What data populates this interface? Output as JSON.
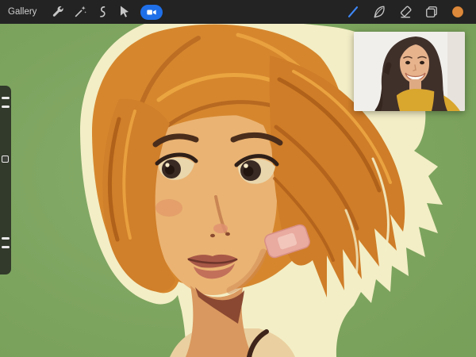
{
  "topbar": {
    "gallery_label": "Gallery",
    "tools_left": [
      {
        "name": "actions-wrench"
      },
      {
        "name": "adjustments-wand"
      },
      {
        "name": "selection-s"
      },
      {
        "name": "transform-arrow"
      },
      {
        "name": "video-record",
        "state": "active"
      }
    ],
    "tools_right": [
      {
        "name": "paint-brush-stroke"
      },
      {
        "name": "smudge-feather"
      },
      {
        "name": "eraser"
      },
      {
        "name": "layers"
      },
      {
        "name": "color-swatch"
      }
    ],
    "colors": {
      "bar_background": "#232323",
      "icon_gray": "#c6c6c6",
      "video_active": "#1f6fe8",
      "brush_accent": "#3e87f5",
      "color_swatch": "#dd893b"
    }
  },
  "sidebar": {
    "items": [
      "brush-size-slider",
      "modify-button",
      "opacity-slider"
    ]
  },
  "canvas": {
    "background_color": "#7fa662",
    "artwork": {
      "subject": "portrait painting of woman with orange bob haircut and bandage on cheek",
      "palette": {
        "outline_cream": "#f3eec6",
        "hair": "#d6872e",
        "hair_shadow": "#a85a17",
        "hair_highlight": "#eda843",
        "skin": "#eab373",
        "lips": "#a85847",
        "bandage": "#e9aaa0",
        "eye_dark": "#3a2a24"
      }
    }
  },
  "reference_photo": {
    "name": "reference-photo",
    "subject": "smiling woman with dark hair in yellow top"
  }
}
